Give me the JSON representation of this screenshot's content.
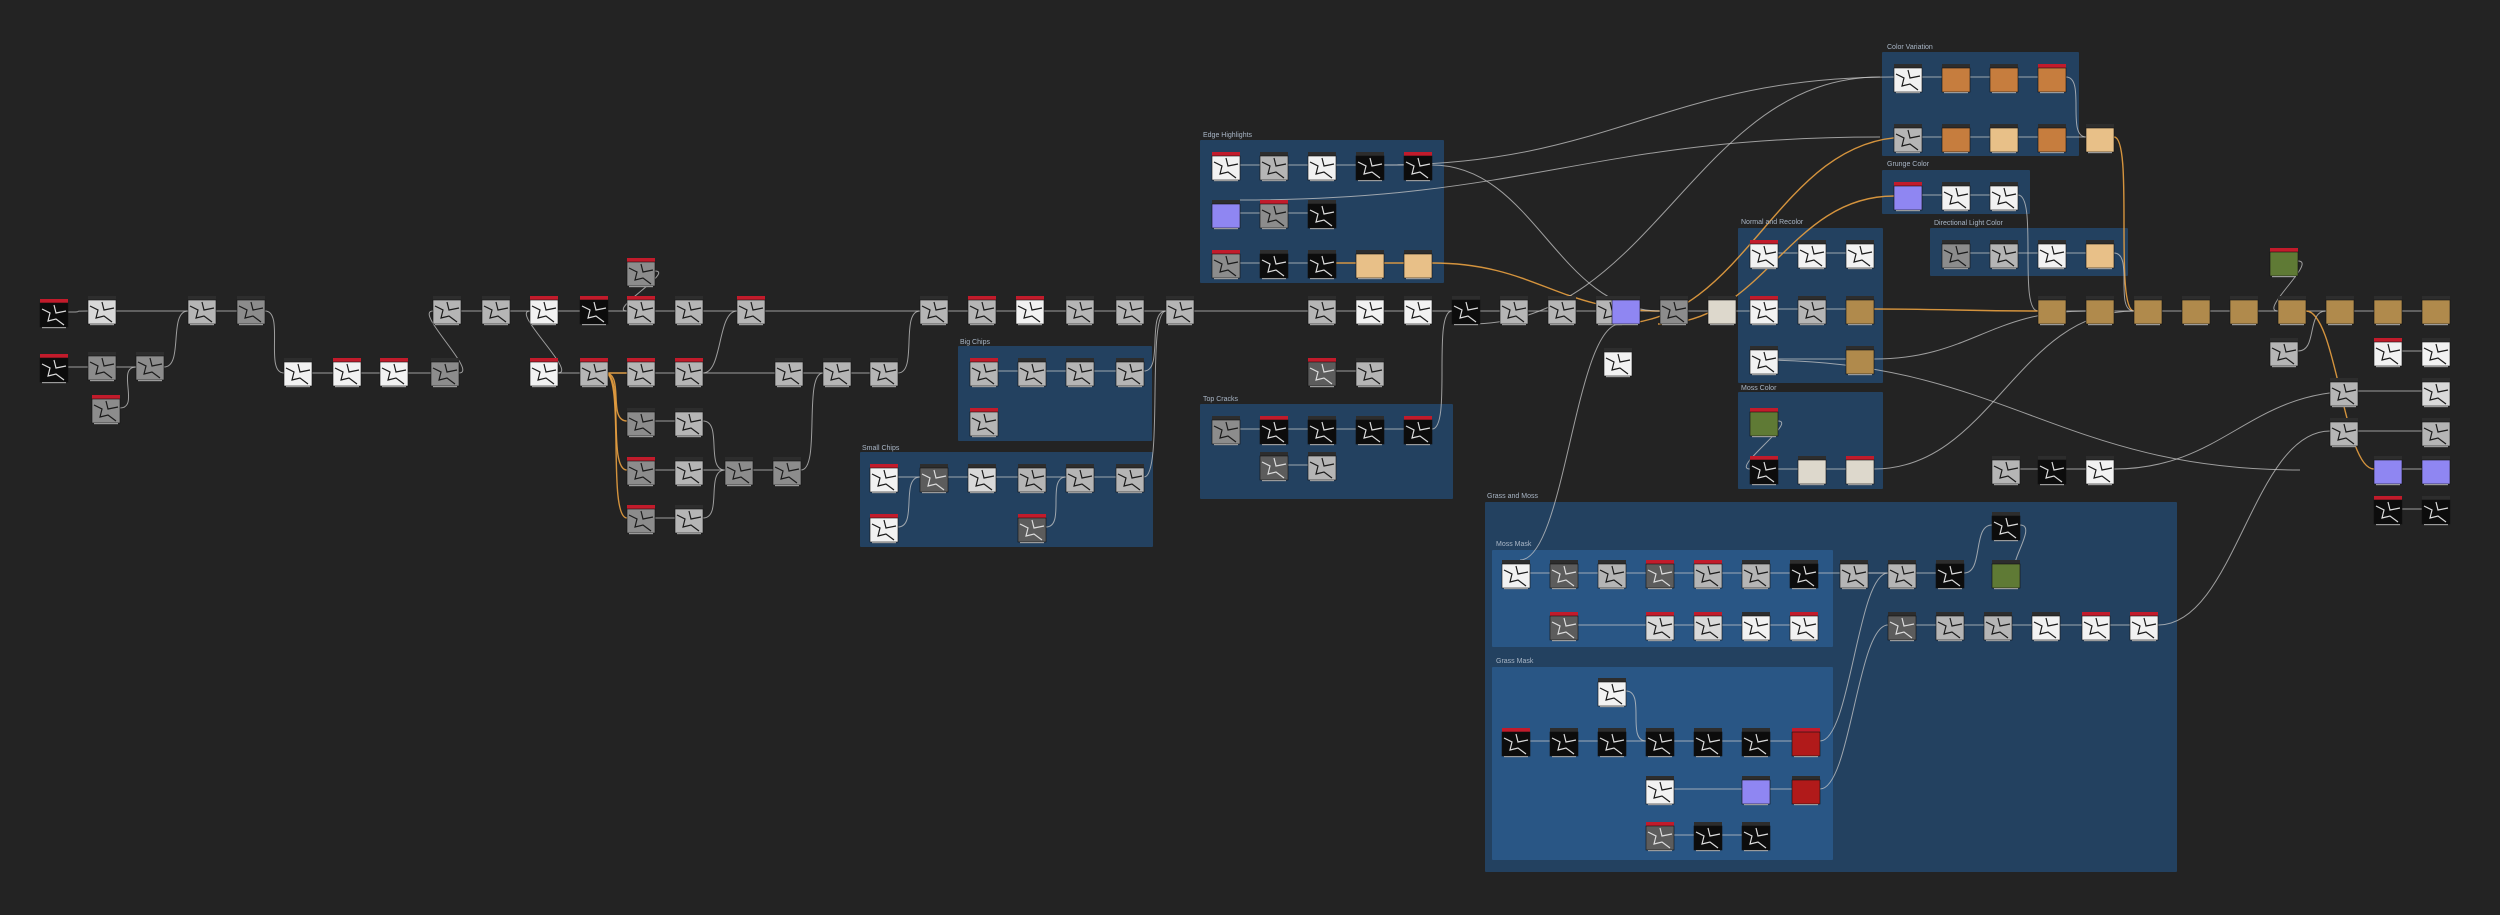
{
  "graph": {
    "background": "#232323",
    "frame_color": "#244466",
    "frame_inner_color": "#2a5a8c",
    "link_white": "#c8c8c8",
    "link_orange": "#e8a040",
    "node_header_red": "#c21b2b",
    "node_header_dark": "#2d2d2d"
  },
  "frames": {
    "color_variation": "Color Variation",
    "edge_highlights": "Edge Highlights",
    "grunge_color": "Grunge Color",
    "directional_light": "Directional Light Color",
    "normal_recolor": "Normal and Recolor",
    "big_chips": "Big Chips",
    "small_chips": "Small Chips",
    "top_cracks": "Top Cracks",
    "moss_color": "Moss Color",
    "grass_and_moss": "Grass and Moss",
    "moss_mask": "Moss Mask",
    "grass_mask": "Grass Mask"
  }
}
